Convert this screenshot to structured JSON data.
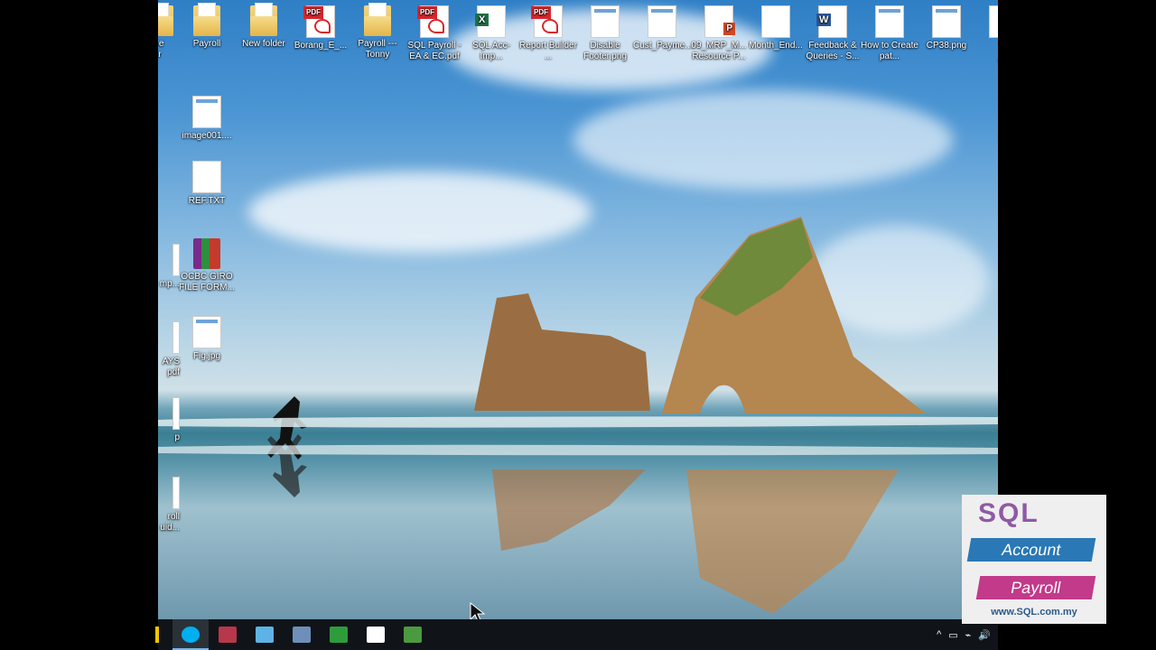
{
  "desktop": {
    "icons_row1": [
      {
        "label": "re\nr",
        "type": "folder"
      },
      {
        "label": "Payroll",
        "type": "folder"
      },
      {
        "label": "New folder",
        "type": "folder"
      },
      {
        "label": "Borang_E_...",
        "type": "pdf"
      },
      {
        "label": "Payroll --- Tonny",
        "type": "folder"
      },
      {
        "label": "SQL Payroll - EA & EC.pdf",
        "type": "pdf"
      },
      {
        "label": "SQL Acc-Imp...",
        "type": "excel"
      },
      {
        "label": "Report Builder ...",
        "type": "pdf"
      },
      {
        "label": "Disable Footer.png",
        "type": "image"
      },
      {
        "label": "Cust_Payme...",
        "type": "image"
      },
      {
        "label": "09_MRP_M... Resource P...",
        "type": "ppt"
      },
      {
        "label": "Month_End...",
        "type": "blank"
      },
      {
        "label": "Feedback & Queries - S...",
        "type": "word"
      },
      {
        "label": "How to Create pat...",
        "type": "image"
      },
      {
        "label": "CP38.png",
        "type": "image"
      },
      {
        "label": "M\n_F",
        "type": "blank"
      }
    ],
    "icons_col": [
      {
        "label": "image001....",
        "type": "image"
      },
      {
        "label": "REF.TXT",
        "type": "text"
      },
      {
        "label": "OCBC GIRO FILE FORM...",
        "type": "rar"
      },
      {
        "label": "Fig.jpg",
        "type": "image"
      }
    ],
    "icons_edge": [
      {
        "label": "mp..."
      },
      {
        "label": "AYS\npdf"
      },
      {
        "label": "p"
      },
      {
        "label": "roll\nuid..."
      }
    ]
  },
  "taskbar": {
    "apps": [
      {
        "name": "skype-icon",
        "color": "#00aff0",
        "active": true
      },
      {
        "name": "winrar-icon",
        "color": "#b8374b",
        "active": false
      },
      {
        "name": "notepad-icon",
        "color": "#5db3e6",
        "active": false
      },
      {
        "name": "window-app-icon",
        "color": "#6e8fb9",
        "active": false
      },
      {
        "name": "camtasia-green-icon",
        "color": "#2f9c3c",
        "active": false
      },
      {
        "name": "camtasia-white-icon",
        "color": "#ffffff",
        "active": false
      },
      {
        "name": "sql-payroll-icon",
        "color": "#4c9a40",
        "active": false
      }
    ],
    "tray": [
      "^",
      "▭",
      "⌁",
      "🔊"
    ]
  },
  "watermark": {
    "brand": "SQL",
    "account": "Account",
    "payroll": "Payroll",
    "website": "www.SQL.com.my"
  }
}
